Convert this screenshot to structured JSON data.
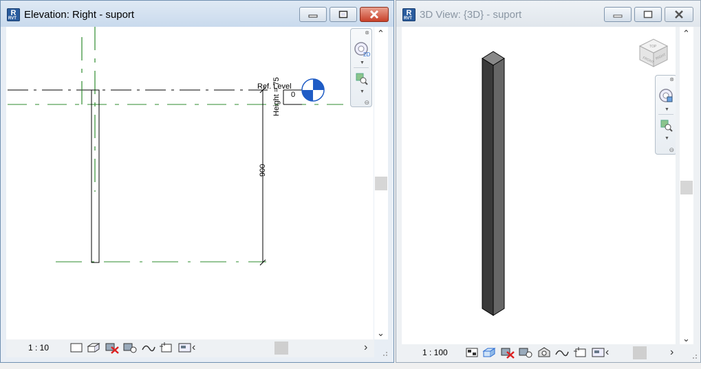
{
  "left_window": {
    "title": "Elevation: Right - suport",
    "scale": "1 : 10",
    "level_label": "Ref. Level",
    "height_label": "Height = 75",
    "offset_value": "0",
    "dimension_value": "900"
  },
  "right_window": {
    "title": "3D View: {3D} - suport",
    "scale": "1 : 100",
    "viewcube_faces": [
      "TOP",
      "FRONT",
      "RIGHT"
    ]
  },
  "colors": {
    "grid_line": "#2e8b2e",
    "level_marker": "#1f5cc5",
    "column_dark": "#3a3a3a",
    "column_mid": "#666666"
  }
}
